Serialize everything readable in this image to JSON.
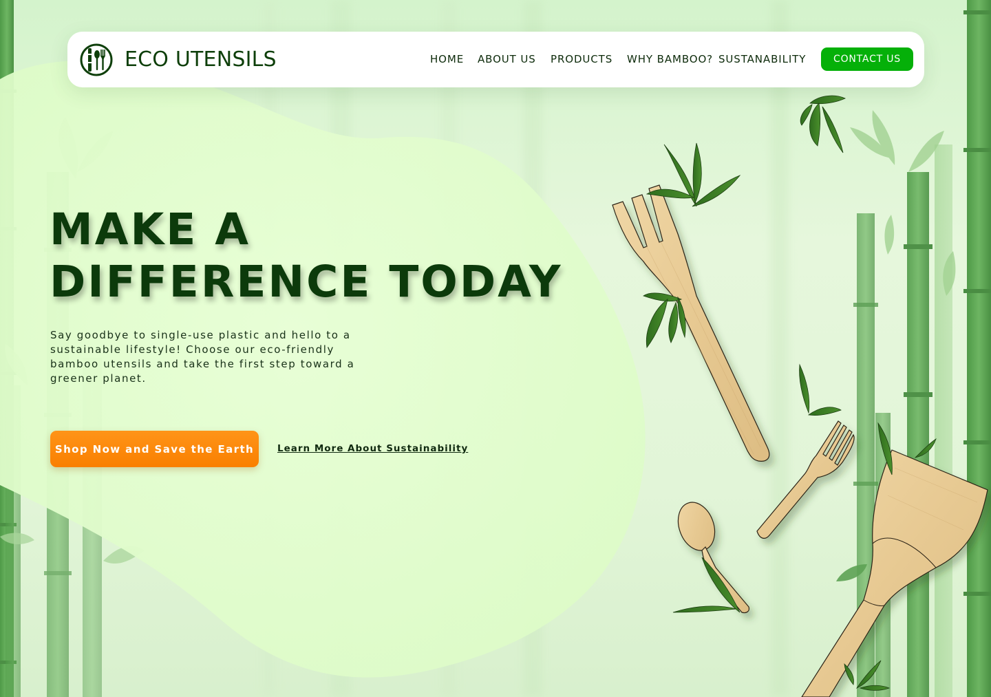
{
  "brand": {
    "name": "ECO UTENSILS",
    "logo_icon": "bamboo-utensils-logo"
  },
  "nav": {
    "items": [
      {
        "label": "HOME"
      },
      {
        "label": "ABOUT US"
      },
      {
        "label": "PRODUCTS"
      },
      {
        "label": "WHY BAMBOO?"
      },
      {
        "label": "SUSTANABILITY"
      }
    ],
    "contact_label": "CONTACT US"
  },
  "hero": {
    "title_line1": "MAKE A",
    "title_line2": "DIFFERENCE TODAY",
    "description": "Say goodbye to single-use plastic and hello to a sustainable lifestyle! Choose our eco-friendly bamboo utensils and take the first step toward a greener planet.",
    "primary_cta": "Shop Now and Save the Earth",
    "secondary_cta": "Learn More About Sustainability"
  },
  "colors": {
    "accent_green": "#05b009",
    "dark_green": "#0c3a0b",
    "cta_orange": "#f98a0c",
    "bamboo_wood": "#e9cf9a"
  },
  "illustrations": [
    "bamboo-fork-icon",
    "small-fork-icon",
    "spoon-icon",
    "spatula-icon",
    "bamboo-leaf-icon",
    "bamboo-stalk-icon"
  ]
}
